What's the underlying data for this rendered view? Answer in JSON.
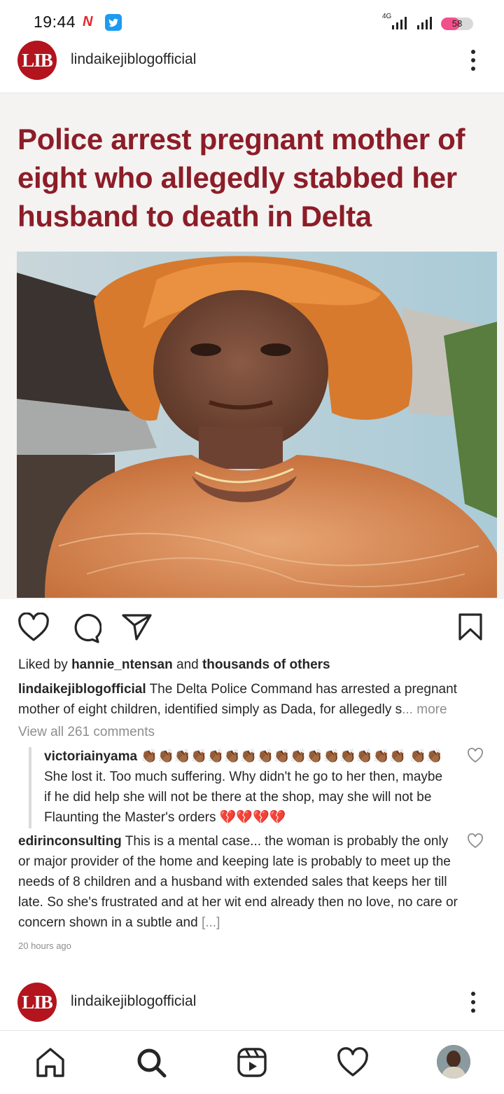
{
  "status_bar": {
    "time": "19:44",
    "network": "4G",
    "battery": "58",
    "battery_level": 0.58
  },
  "post": {
    "username": "lindaikejiblogofficial",
    "avatar_text": "LIB",
    "headline": "Police arrest pregnant mother of eight who allegedly stabbed her husband to death in Delta",
    "liked_prefix": "Liked by",
    "liked_user": "hannie_ntensan",
    "liked_and": "and",
    "liked_others": "thousands of others",
    "caption_user": "lindaikejiblogofficial",
    "caption_text": "The Delta Police Command has arrested a pregnant mother of eight children, identified simply as Dada, for allegedly s",
    "caption_more": "... more",
    "view_all": "View all 261 comments",
    "comments": [
      {
        "user": "victoriainyama",
        "emojis": "👏🏾👏🏾👏🏾👏🏾👏🏾👏🏾👏🏾👏🏾👏🏾👏🏾👏🏾👏🏾👏🏾👏🏾👏🏾👏🏾 👏🏾👏🏾",
        "text": "She lost it. Too much suffering. Why didn't he go to her then, maybe if he did help she will not be there at the shop, may she will not be Flaunting the Master's orders",
        "end_emojis": "💔💔💔💔"
      },
      {
        "user": "edirinconsulting",
        "text": "This is a mental case... the woman is probably the only or major provider of the home and keeping late is probably to meet up the needs of 8 children and a husband with extended sales that keeps her till late. So she's frustrated and at her wit end already then no love, no care or concern shown in a subtle and",
        "more": "[...]"
      }
    ],
    "timestamp": "20 hours ago"
  },
  "next_post": {
    "username": "lindaikejiblogofficial",
    "avatar_text": "LIB"
  },
  "nav": [
    "home-icon",
    "search-icon",
    "reels-icon",
    "heart-icon",
    "profile-avatar"
  ],
  "colors": {
    "headline": "#8c1d28",
    "avatar_bg": "#b3141d",
    "battery": "#f2508a",
    "broken_heart": "#c8102e"
  }
}
